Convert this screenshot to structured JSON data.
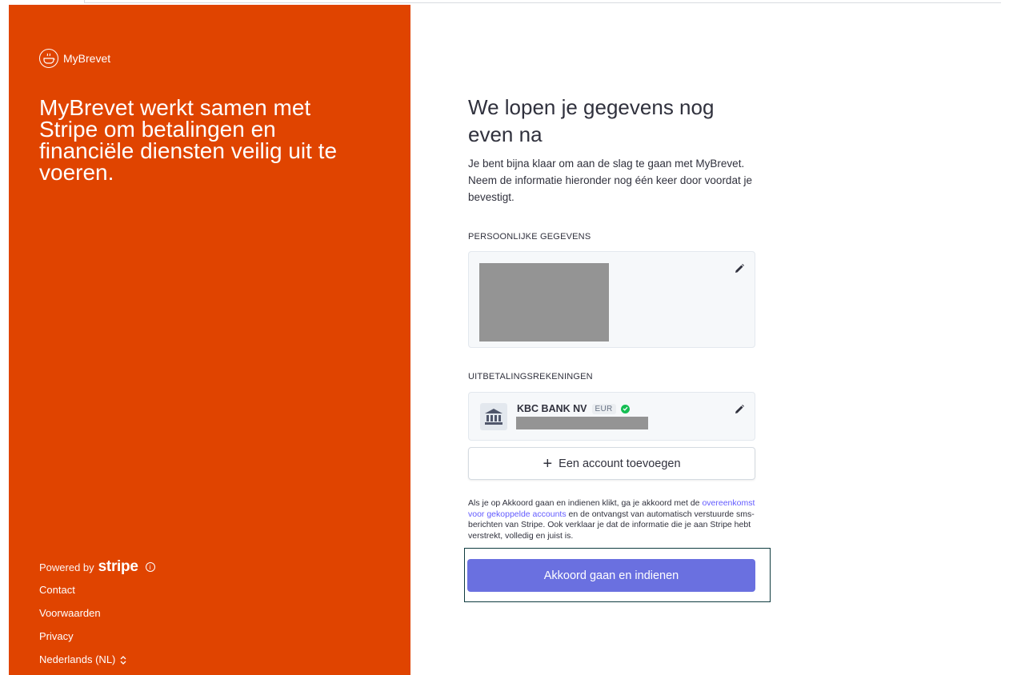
{
  "brand": {
    "logo_icon": "pot-icon",
    "name": "MyBrevet",
    "headline": "MyBrevet werkt samen met Stripe om betalingen en financiële diensten veilig uit te voeren.",
    "accent_color": "#e04400"
  },
  "footer": {
    "powered_by": "Powered by",
    "stripe_wordmark": "stripe",
    "links": {
      "contact": "Contact",
      "terms": "Voorwaarden",
      "privacy": "Privacy"
    },
    "language": "Nederlands (NL)"
  },
  "main": {
    "title": "We lopen je gegevens nog even na",
    "intro": "Je bent bijna klaar om aan de slag te gaan met MyBrevet. Neem de informatie hieronder nog één keer door voordat je bevestigt.",
    "personal": {
      "label": "PERSOONLIJKE GEGEVENS"
    },
    "payout": {
      "label": "UITBETALINGSREKENINGEN",
      "bank_name": "KBC BANK NV",
      "currency": "EUR",
      "verified_icon": "check-circle-icon"
    },
    "add_account_label": "Een account toevoegen",
    "legal": {
      "before": "Als je op Akkoord gaan en indienen klikt, ga je akkoord met de ",
      "link": "overeenkomst voor gekoppelde accounts",
      "after": " en de ontvangst van automatisch verstuurde sms-berichten van Stripe. Ook verklaar je dat de informatie die je aan Stripe hebt verstrekt, volledig en juist is."
    },
    "submit_label": "Akkoord gaan en indienen",
    "submit_color": "#6a70e0"
  }
}
